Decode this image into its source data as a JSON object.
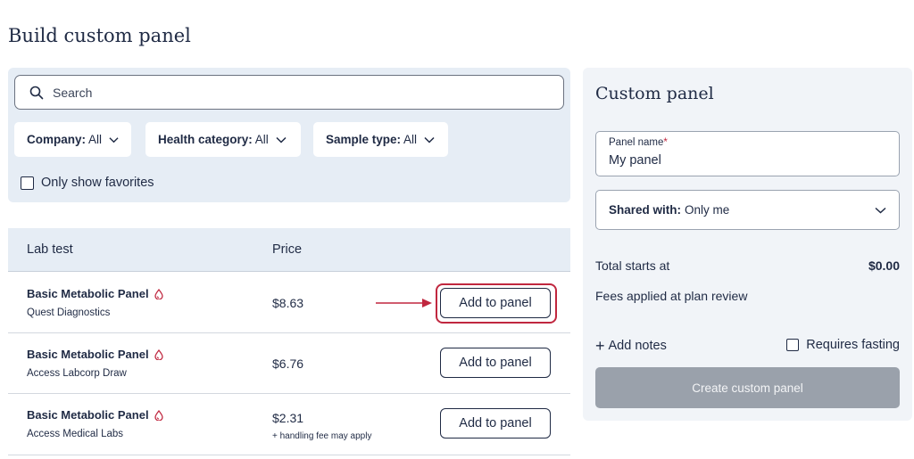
{
  "page": {
    "title": "Build custom panel"
  },
  "filters": {
    "search_placeholder": "Search",
    "company": {
      "label": "Company:",
      "value": "All"
    },
    "health_category": {
      "label": "Health category:",
      "value": "All"
    },
    "sample_type": {
      "label": "Sample type:",
      "value": "All"
    },
    "favorites_label": "Only show favorites"
  },
  "table": {
    "headers": {
      "test": "Lab test",
      "price": "Price"
    },
    "rows": [
      {
        "name": "Basic Metabolic Panel",
        "lab": "Quest Diagnostics",
        "price": "$8.63",
        "fee": "",
        "button": "Add to panel",
        "highlighted": true
      },
      {
        "name": "Basic Metabolic Panel",
        "lab": "Access Labcorp Draw",
        "price": "$6.76",
        "fee": "",
        "button": "Add to panel",
        "highlighted": false
      },
      {
        "name": "Basic Metabolic Panel",
        "lab": "Access Medical Labs",
        "price": "$2.31",
        "fee": "+ handling fee may apply",
        "button": "Add to panel",
        "highlighted": false
      }
    ]
  },
  "custom_panel": {
    "title": "Custom panel",
    "name_label": "Panel name",
    "name_required_mark": "*",
    "name_value": "My panel",
    "shared_label": "Shared with:",
    "shared_value": "Only me",
    "total_label": "Total starts at",
    "total_value": "$0.00",
    "fees_text": "Fees applied at plan review",
    "add_notes_label": "Add notes",
    "requires_fasting_label": "Requires fasting",
    "create_button": "Create custom panel"
  },
  "colors": {
    "accent_red": "#c0273f",
    "panel_bg": "#e6edf5",
    "text": "#1f2a44",
    "disabled_button": "#9aa1ab"
  },
  "icons": {
    "search": "search-icon",
    "chevron": "chevron-down-icon",
    "sample": "blood-drop-icon",
    "arrow": "arrow-right-icon"
  }
}
